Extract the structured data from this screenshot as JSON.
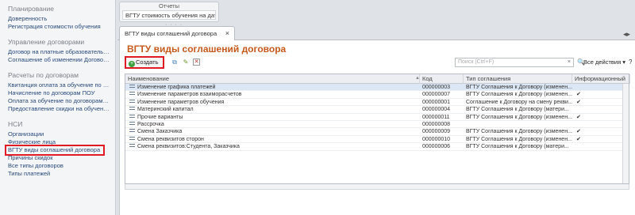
{
  "sidebar": {
    "sections": [
      {
        "title": "Планирование",
        "items": [
          "Доверенность",
          "Регистрация стоимости обучения"
        ]
      },
      {
        "title": "Управление договорами",
        "items": [
          "Договор на платные образовательные услуги",
          "Соглашение об изменении Договора"
        ]
      },
      {
        "title": "Расчеты по договорам",
        "items": [
          "Квитанция оплата за обучение по договору",
          "Начисление по договорам ПОУ",
          "Оплата за обучение по договорам ПОУ",
          "Предоставление скидки на обучение"
        ]
      },
      {
        "title": "НСИ",
        "items": [
          "Организации",
          "Физические лица",
          "ВГТУ виды соглашений договора",
          "Причины скидок",
          "Все типы договоров",
          "Типы платежей"
        ]
      }
    ]
  },
  "reports": {
    "title": "Отчеты",
    "item": "ВГТУ стоимость обучения на дату"
  },
  "tab": {
    "label": "ВГТУ виды соглашений договора",
    "close": "×"
  },
  "page": {
    "title": "ВГТУ виды соглашений договора"
  },
  "toolbar": {
    "create_label": "Создать",
    "search_placeholder": "Поиск (Ctrl+F)",
    "actions_label": "Все действия ▾"
  },
  "table": {
    "columns": [
      "Наименование",
      "Код",
      "Тип соглашения",
      "Информационный"
    ],
    "rows": [
      {
        "name": "Изменение графика платежей",
        "code": "000000003",
        "type": "ВГТУ Соглашения к Договору (изменен...",
        "info": "",
        "selected": true
      },
      {
        "name": "Изменение параметров взаиморасчетов",
        "code": "000000007",
        "type": "ВГТУ Соглашения к Договору (изменен...",
        "info": "✔",
        "selected": false
      },
      {
        "name": "Изменение параметров обучения",
        "code": "000000001",
        "type": "Соглашение к Договору на смену рекви...",
        "info": "✔",
        "selected": false
      },
      {
        "name": "Материнский капитал",
        "code": "000000004",
        "type": "ВГТУ Соглашения к Договору (матери...",
        "info": "",
        "selected": false
      },
      {
        "name": "Прочие варианты",
        "code": "000000011",
        "type": "ВГТУ Соглашения к Договору (изменен...",
        "info": "✔",
        "selected": false
      },
      {
        "name": "Рассрочка",
        "code": "000000008",
        "type": "",
        "info": "",
        "selected": false
      },
      {
        "name": "Смена Заказчика",
        "code": "000000009",
        "type": "ВГТУ Соглашения к Договору (изменен...",
        "info": "✔",
        "selected": false
      },
      {
        "name": "Смена реквизитов сторон",
        "code": "000000010",
        "type": "ВГТУ Соглашения к Договору (изменен...",
        "info": "✔",
        "selected": false
      },
      {
        "name": "Смена реквизитов:Студента, Заказчика",
        "code": "000000006",
        "type": "ВГТУ Соглашения к Договору (матери...",
        "info": "",
        "selected": false
      }
    ]
  },
  "colors": {
    "accent_title": "#c4591c",
    "highlight": "#e01b24",
    "selected_row": "#dbe7f5"
  }
}
